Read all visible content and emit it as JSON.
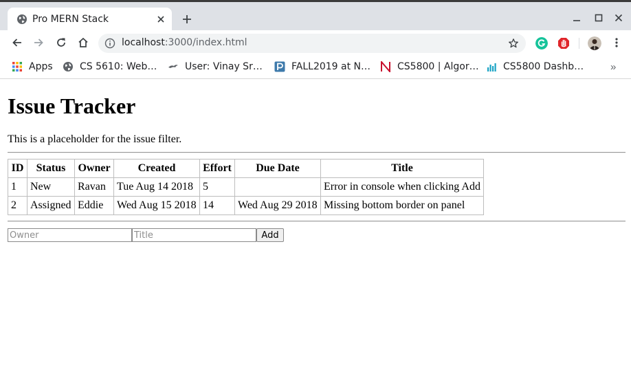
{
  "browser": {
    "tab": {
      "title": "Pro MERN Stack",
      "close_icon": "close-icon"
    },
    "new_tab_icon": "plus-icon",
    "window_buttons": [
      "minimize-icon",
      "maximize-icon",
      "close-icon"
    ],
    "url": {
      "host": "localhost",
      "rest": ":3000/index.html"
    },
    "bookmarks": [
      {
        "label": "Apps",
        "icon": "apps-grid-icon"
      },
      {
        "label": "CS 5610: Web…",
        "icon": "globe-icon"
      },
      {
        "label": "User: Vinay Sr…",
        "icon": "bird-icon"
      },
      {
        "label": "FALL2019 at N…",
        "icon": "piazza-icon"
      },
      {
        "label": "CS5800 | Algor…",
        "icon": "northeastern-n-icon"
      },
      {
        "label": "CS5800 Dashb…",
        "icon": "bar-chart-icon"
      }
    ],
    "bookmarks_overflow": "»",
    "colors": {
      "titlebar": "#dee1e6",
      "omnibox": "#f1f3f4",
      "grammarly": "#15c39a",
      "adblock": "#e0262b"
    }
  },
  "page": {
    "title": "Issue Tracker",
    "filter_placeholder": "This is a placeholder for the issue filter.",
    "table": {
      "headers": [
        "ID",
        "Status",
        "Owner",
        "Created",
        "Effort",
        "Due Date",
        "Title"
      ],
      "rows": [
        [
          "1",
          "New",
          "Ravan",
          "Tue Aug 14 2018",
          "5",
          "",
          "Error in console when clicking Add"
        ],
        [
          "2",
          "Assigned",
          "Eddie",
          "Wed Aug 15 2018",
          "14",
          "Wed Aug 29 2018",
          "Missing bottom border on panel"
        ]
      ]
    },
    "form": {
      "owner_placeholder": "Owner",
      "title_placeholder": "Title",
      "add_label": "Add"
    }
  }
}
